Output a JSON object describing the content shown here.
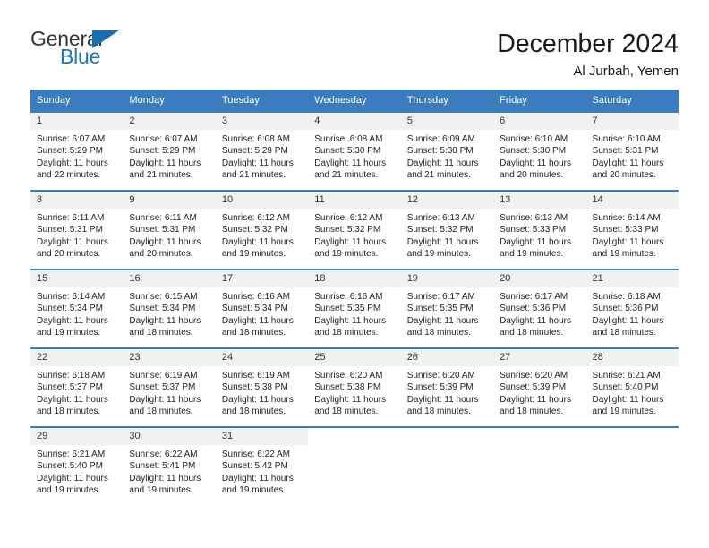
{
  "brand": {
    "name_part1": "General",
    "name_part2": "Blue",
    "triangle_color": "#1b6cb0",
    "blue_color": "#1b75bb"
  },
  "header": {
    "title": "December 2024",
    "subtitle": "Al Jurbah, Yemen"
  },
  "theme": {
    "header_bg": "#3a7cbe",
    "daynum_bg": "#f1f1f1",
    "text_color": "#222222"
  },
  "weekday_headers": [
    "Sunday",
    "Monday",
    "Tuesday",
    "Wednesday",
    "Thursday",
    "Friday",
    "Saturday"
  ],
  "weeks": [
    [
      {
        "day": "1",
        "sunrise": "Sunrise: 6:07 AM",
        "sunset": "Sunset: 5:29 PM",
        "daylight_1": "Daylight: 11 hours",
        "daylight_2": "and 22 minutes."
      },
      {
        "day": "2",
        "sunrise": "Sunrise: 6:07 AM",
        "sunset": "Sunset: 5:29 PM",
        "daylight_1": "Daylight: 11 hours",
        "daylight_2": "and 21 minutes."
      },
      {
        "day": "3",
        "sunrise": "Sunrise: 6:08 AM",
        "sunset": "Sunset: 5:29 PM",
        "daylight_1": "Daylight: 11 hours",
        "daylight_2": "and 21 minutes."
      },
      {
        "day": "4",
        "sunrise": "Sunrise: 6:08 AM",
        "sunset": "Sunset: 5:30 PM",
        "daylight_1": "Daylight: 11 hours",
        "daylight_2": "and 21 minutes."
      },
      {
        "day": "5",
        "sunrise": "Sunrise: 6:09 AM",
        "sunset": "Sunset: 5:30 PM",
        "daylight_1": "Daylight: 11 hours",
        "daylight_2": "and 21 minutes."
      },
      {
        "day": "6",
        "sunrise": "Sunrise: 6:10 AM",
        "sunset": "Sunset: 5:30 PM",
        "daylight_1": "Daylight: 11 hours",
        "daylight_2": "and 20 minutes."
      },
      {
        "day": "7",
        "sunrise": "Sunrise: 6:10 AM",
        "sunset": "Sunset: 5:31 PM",
        "daylight_1": "Daylight: 11 hours",
        "daylight_2": "and 20 minutes."
      }
    ],
    [
      {
        "day": "8",
        "sunrise": "Sunrise: 6:11 AM",
        "sunset": "Sunset: 5:31 PM",
        "daylight_1": "Daylight: 11 hours",
        "daylight_2": "and 20 minutes."
      },
      {
        "day": "9",
        "sunrise": "Sunrise: 6:11 AM",
        "sunset": "Sunset: 5:31 PM",
        "daylight_1": "Daylight: 11 hours",
        "daylight_2": "and 20 minutes."
      },
      {
        "day": "10",
        "sunrise": "Sunrise: 6:12 AM",
        "sunset": "Sunset: 5:32 PM",
        "daylight_1": "Daylight: 11 hours",
        "daylight_2": "and 19 minutes."
      },
      {
        "day": "11",
        "sunrise": "Sunrise: 6:12 AM",
        "sunset": "Sunset: 5:32 PM",
        "daylight_1": "Daylight: 11 hours",
        "daylight_2": "and 19 minutes."
      },
      {
        "day": "12",
        "sunrise": "Sunrise: 6:13 AM",
        "sunset": "Sunset: 5:32 PM",
        "daylight_1": "Daylight: 11 hours",
        "daylight_2": "and 19 minutes."
      },
      {
        "day": "13",
        "sunrise": "Sunrise: 6:13 AM",
        "sunset": "Sunset: 5:33 PM",
        "daylight_1": "Daylight: 11 hours",
        "daylight_2": "and 19 minutes."
      },
      {
        "day": "14",
        "sunrise": "Sunrise: 6:14 AM",
        "sunset": "Sunset: 5:33 PM",
        "daylight_1": "Daylight: 11 hours",
        "daylight_2": "and 19 minutes."
      }
    ],
    [
      {
        "day": "15",
        "sunrise": "Sunrise: 6:14 AM",
        "sunset": "Sunset: 5:34 PM",
        "daylight_1": "Daylight: 11 hours",
        "daylight_2": "and 19 minutes."
      },
      {
        "day": "16",
        "sunrise": "Sunrise: 6:15 AM",
        "sunset": "Sunset: 5:34 PM",
        "daylight_1": "Daylight: 11 hours",
        "daylight_2": "and 18 minutes."
      },
      {
        "day": "17",
        "sunrise": "Sunrise: 6:16 AM",
        "sunset": "Sunset: 5:34 PM",
        "daylight_1": "Daylight: 11 hours",
        "daylight_2": "and 18 minutes."
      },
      {
        "day": "18",
        "sunrise": "Sunrise: 6:16 AM",
        "sunset": "Sunset: 5:35 PM",
        "daylight_1": "Daylight: 11 hours",
        "daylight_2": "and 18 minutes."
      },
      {
        "day": "19",
        "sunrise": "Sunrise: 6:17 AM",
        "sunset": "Sunset: 5:35 PM",
        "daylight_1": "Daylight: 11 hours",
        "daylight_2": "and 18 minutes."
      },
      {
        "day": "20",
        "sunrise": "Sunrise: 6:17 AM",
        "sunset": "Sunset: 5:36 PM",
        "daylight_1": "Daylight: 11 hours",
        "daylight_2": "and 18 minutes."
      },
      {
        "day": "21",
        "sunrise": "Sunrise: 6:18 AM",
        "sunset": "Sunset: 5:36 PM",
        "daylight_1": "Daylight: 11 hours",
        "daylight_2": "and 18 minutes."
      }
    ],
    [
      {
        "day": "22",
        "sunrise": "Sunrise: 6:18 AM",
        "sunset": "Sunset: 5:37 PM",
        "daylight_1": "Daylight: 11 hours",
        "daylight_2": "and 18 minutes."
      },
      {
        "day": "23",
        "sunrise": "Sunrise: 6:19 AM",
        "sunset": "Sunset: 5:37 PM",
        "daylight_1": "Daylight: 11 hours",
        "daylight_2": "and 18 minutes."
      },
      {
        "day": "24",
        "sunrise": "Sunrise: 6:19 AM",
        "sunset": "Sunset: 5:38 PM",
        "daylight_1": "Daylight: 11 hours",
        "daylight_2": "and 18 minutes."
      },
      {
        "day": "25",
        "sunrise": "Sunrise: 6:20 AM",
        "sunset": "Sunset: 5:38 PM",
        "daylight_1": "Daylight: 11 hours",
        "daylight_2": "and 18 minutes."
      },
      {
        "day": "26",
        "sunrise": "Sunrise: 6:20 AM",
        "sunset": "Sunset: 5:39 PM",
        "daylight_1": "Daylight: 11 hours",
        "daylight_2": "and 18 minutes."
      },
      {
        "day": "27",
        "sunrise": "Sunrise: 6:20 AM",
        "sunset": "Sunset: 5:39 PM",
        "daylight_1": "Daylight: 11 hours",
        "daylight_2": "and 18 minutes."
      },
      {
        "day": "28",
        "sunrise": "Sunrise: 6:21 AM",
        "sunset": "Sunset: 5:40 PM",
        "daylight_1": "Daylight: 11 hours",
        "daylight_2": "and 19 minutes."
      }
    ],
    [
      {
        "day": "29",
        "sunrise": "Sunrise: 6:21 AM",
        "sunset": "Sunset: 5:40 PM",
        "daylight_1": "Daylight: 11 hours",
        "daylight_2": "and 19 minutes."
      },
      {
        "day": "30",
        "sunrise": "Sunrise: 6:22 AM",
        "sunset": "Sunset: 5:41 PM",
        "daylight_1": "Daylight: 11 hours",
        "daylight_2": "and 19 minutes."
      },
      {
        "day": "31",
        "sunrise": "Sunrise: 6:22 AM",
        "sunset": "Sunset: 5:42 PM",
        "daylight_1": "Daylight: 11 hours",
        "daylight_2": "and 19 minutes."
      },
      null,
      null,
      null,
      null
    ]
  ]
}
